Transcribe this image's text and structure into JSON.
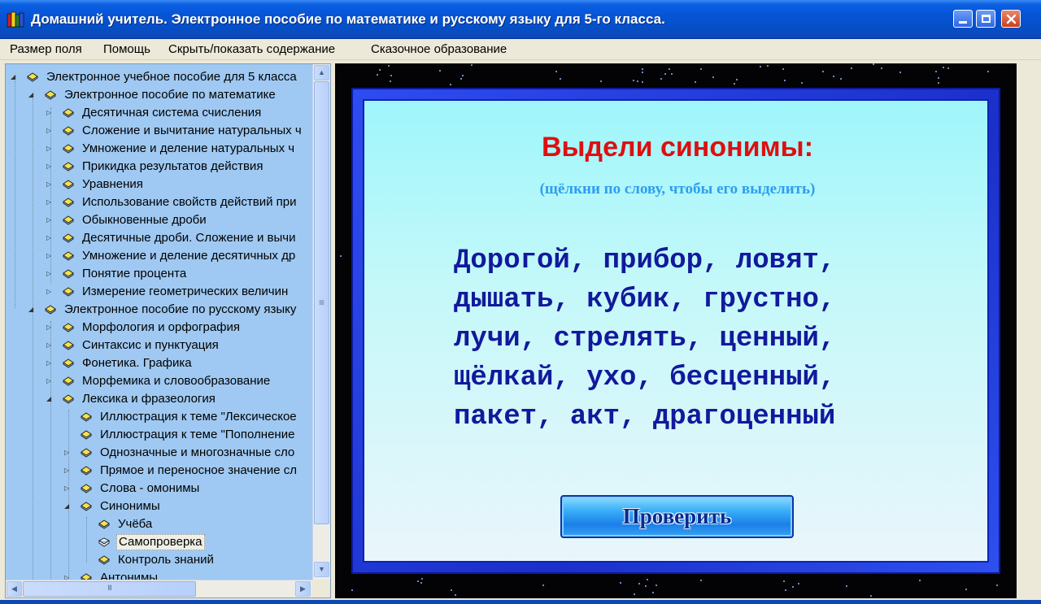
{
  "window": {
    "title": "Домашний учитель. Электронное пособие по математике и русскому языку для 5-го класса."
  },
  "menu": {
    "items": [
      {
        "label": "Размер поля"
      },
      {
        "label": "Помощь"
      },
      {
        "label": "Скрыть/показать содержание"
      },
      {
        "label": "Сказочное образование"
      }
    ]
  },
  "tree": {
    "items": [
      {
        "label": "Электронное учебное пособие для 5 класса",
        "level": 0,
        "expander": "expanded"
      },
      {
        "label": "Электронное пособие по математике",
        "level": 1,
        "expander": "expanded"
      },
      {
        "label": "Десятичная система счисления",
        "level": 2,
        "expander": "collapsed"
      },
      {
        "label": "Сложение и вычитание натуральных ч",
        "level": 2,
        "expander": "collapsed"
      },
      {
        "label": "Умножение и деление натуральных ч",
        "level": 2,
        "expander": "collapsed"
      },
      {
        "label": "Прикидка результатов действия",
        "level": 2,
        "expander": "collapsed"
      },
      {
        "label": "Уравнения",
        "level": 2,
        "expander": "collapsed"
      },
      {
        "label": "Использование свойств действий при",
        "level": 2,
        "expander": "collapsed"
      },
      {
        "label": "Обыкновенные дроби",
        "level": 2,
        "expander": "collapsed"
      },
      {
        "label": "Десятичные дроби. Сложение и вычи",
        "level": 2,
        "expander": "collapsed"
      },
      {
        "label": "Умножение и деление десятичных др",
        "level": 2,
        "expander": "collapsed"
      },
      {
        "label": "Понятие процента",
        "level": 2,
        "expander": "collapsed"
      },
      {
        "label": "Измерение геометрических величин",
        "level": 2,
        "expander": "collapsed"
      },
      {
        "label": "Электронное пособие по русскому языку",
        "level": 1,
        "expander": "expanded"
      },
      {
        "label": "Морфология и орфография",
        "level": 2,
        "expander": "collapsed"
      },
      {
        "label": "Синтаксис и пунктуация",
        "level": 2,
        "expander": "collapsed"
      },
      {
        "label": "Фонетика. Графика",
        "level": 2,
        "expander": "collapsed"
      },
      {
        "label": "Морфемика и словообразование",
        "level": 2,
        "expander": "collapsed"
      },
      {
        "label": "Лексика и фразеология",
        "level": 2,
        "expander": "expanded"
      },
      {
        "label": "Иллюстрация к теме \"Лексическое",
        "level": 3,
        "expander": "none"
      },
      {
        "label": "Иллюстрация к теме \"Пополнение",
        "level": 3,
        "expander": "none"
      },
      {
        "label": "Однозначные и многозначные сло",
        "level": 3,
        "expander": "collapsed"
      },
      {
        "label": "Прямое и переносное значение сл",
        "level": 3,
        "expander": "collapsed"
      },
      {
        "label": "Слова - омонимы",
        "level": 3,
        "expander": "collapsed"
      },
      {
        "label": "Синонимы",
        "level": 3,
        "expander": "expanded"
      },
      {
        "label": "Учёба",
        "level": 4,
        "expander": "none"
      },
      {
        "label": "Самопроверка",
        "level": 4,
        "expander": "none",
        "selected": true
      },
      {
        "label": "Контроль знаний",
        "level": 4,
        "expander": "none"
      },
      {
        "label": "Антонимы",
        "level": 3,
        "expander": "collapsed"
      }
    ],
    "vscroll_glyph": "≡",
    "hscroll_glyph": "III"
  },
  "exercise": {
    "title": "Выдели синонимы:",
    "hint": "(щёлкни по слову, чтобы его выделить)",
    "lines": [
      [
        "Дорогой,",
        "прибор,",
        "ловят,"
      ],
      [
        "дышать,",
        "кубик,",
        "грустно,"
      ],
      [
        "лучи,",
        "стрелять,",
        "ценный,"
      ],
      [
        "щёлкай,",
        "ухо,",
        "бесценный,"
      ],
      [
        "пакет,",
        "акт,",
        "драгоценный"
      ]
    ],
    "check_button": "Проверить"
  },
  "colors": {
    "title_bar": "#0654d6",
    "tree_background": "#9fc9f2",
    "exercise_title": "#dd1010",
    "exercise_hint": "#2e9ef0",
    "exercise_words": "#12199c"
  }
}
